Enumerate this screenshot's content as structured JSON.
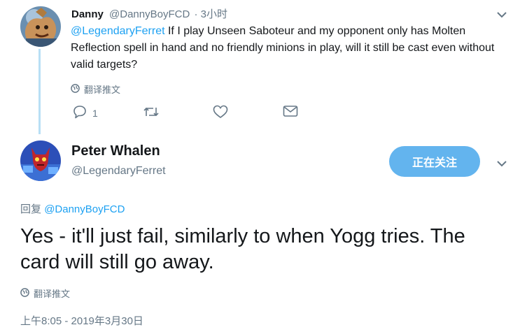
{
  "reply": {
    "name": "Danny",
    "handle": "@DannyBoyFCD",
    "time": "· 3小时",
    "mention": "@LegendaryFerret",
    "text": " If I play Unseen Saboteur and my opponent only has Molten Reflection spell in hand and no friendly minions in play, will it still be cast even without valid targets?",
    "translate": "翻译推文",
    "reply_count": "1"
  },
  "tweet": {
    "name": "Peter Whalen",
    "handle": "@LegendaryFerret",
    "follow_label": "正在关注",
    "reply_prefix": "回复",
    "reply_mention": "@DannyBoyFCD",
    "text": "Yes - it'll just fail, similarly to when Yogg tries. The card will still go away.",
    "translate": "翻译推文",
    "timestamp": "上午8:05 - 2019年3月30日"
  },
  "colors": {
    "link": "#1da1f2",
    "follow_button": "#63b4ee",
    "thread_line": "#b8dff5",
    "muted": "#657786"
  },
  "icons": [
    "globe-icon",
    "reply-icon",
    "retweet-icon",
    "like-icon",
    "message-icon",
    "chevron-down-icon"
  ]
}
